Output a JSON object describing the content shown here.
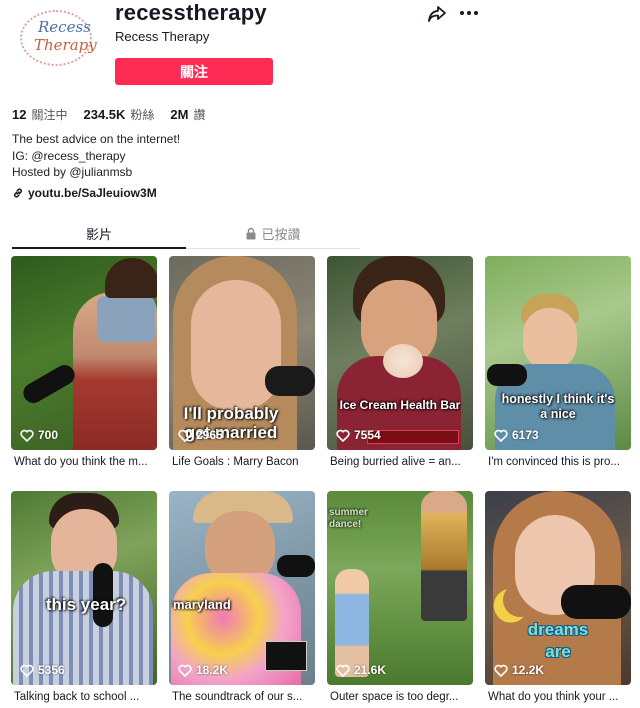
{
  "profile": {
    "username": "recesstherapy",
    "nickname": "Recess Therapy",
    "avatar_text_1": "Recess",
    "avatar_text_2": "Therapy",
    "follow_label": "關注"
  },
  "stats": {
    "following_count": "12",
    "following_label": "關注中",
    "followers_count": "234.5K",
    "followers_label": "粉絲",
    "likes_count": "2M",
    "likes_label": "讚"
  },
  "bio": {
    "line1": "The best advice on the internet!",
    "line2": "IG: @recess_therapy",
    "line3": "Hosted by @julianmsb"
  },
  "link": {
    "text": "youtu.be/SaJleuiow3M"
  },
  "tabs": {
    "videos": "影片",
    "liked": "已按讚"
  },
  "videos": [
    {
      "views": "700",
      "caption": "What do you think the m...",
      "overlay": ""
    },
    {
      "views": "2965",
      "caption": "Life Goals : Marry Bacon",
      "overlay": "I'll probably get married"
    },
    {
      "views": "7554",
      "caption": "Being burried alive = an...",
      "overlay": "Ice Cream Health Bar"
    },
    {
      "views": "6173",
      "caption": "I'm convinced this is pro...",
      "overlay": "honestly I think it's a nice"
    },
    {
      "views": "5356",
      "caption": "Talking back to school ...",
      "overlay": "this year?"
    },
    {
      "views": "18.2K",
      "caption": "The soundtrack of our s...",
      "overlay": "maryland"
    },
    {
      "views": "21.6K",
      "caption": "Outer space is too degr...",
      "overlay": "summer dance!"
    },
    {
      "views": "12.2K",
      "caption": "What do you think your ...",
      "overlay": "dreams are"
    }
  ],
  "colors": {
    "accent": "#fe2c55",
    "text": "#161823"
  }
}
